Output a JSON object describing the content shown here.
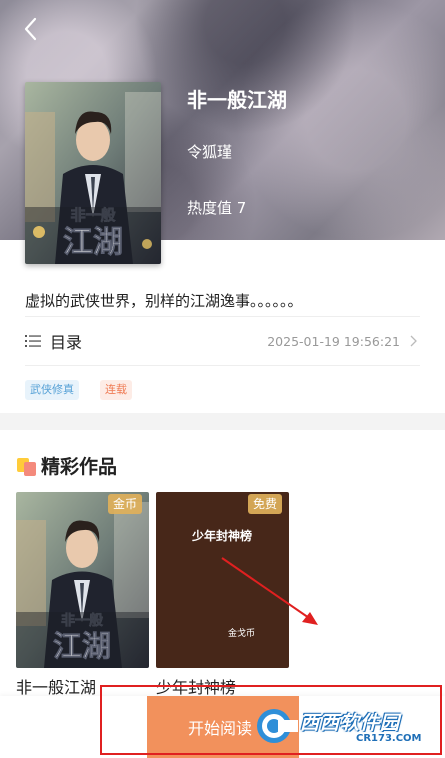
{
  "header": {
    "back_icon": "chevron-left-icon"
  },
  "book": {
    "title": "非一般江湖",
    "author": "令狐瑾",
    "heat": "热度值 7",
    "cover_title": "非一般",
    "cover_subtitle": "江湖",
    "description": "虚拟的武侠世界，别样的江湖逸事。。。。。。",
    "tags": [
      "武侠修真",
      "连载"
    ]
  },
  "catalog": {
    "icon": "list-icon",
    "label": "目录",
    "updated": "2025-01-19 19:56:21"
  },
  "recommend": {
    "title": "精彩作品",
    "items": [
      {
        "name": "非一般江湖",
        "badge": "金币",
        "cover_title": "非一般",
        "cover_subtitle": "江湖"
      },
      {
        "name": "少年封神榜",
        "badge": "免费",
        "cover_title": "少年封神榜",
        "cover_sub": "金戈币"
      }
    ]
  },
  "footer": {
    "start_label": "开始阅读"
  },
  "watermark": {
    "main": "西西软件园",
    "sub": "CR173.COM"
  },
  "colors": {
    "accent": "#f2915c",
    "annotation": "#e02020",
    "tag_blue": "#56a1d6",
    "tag_orange": "#ef7a53"
  }
}
